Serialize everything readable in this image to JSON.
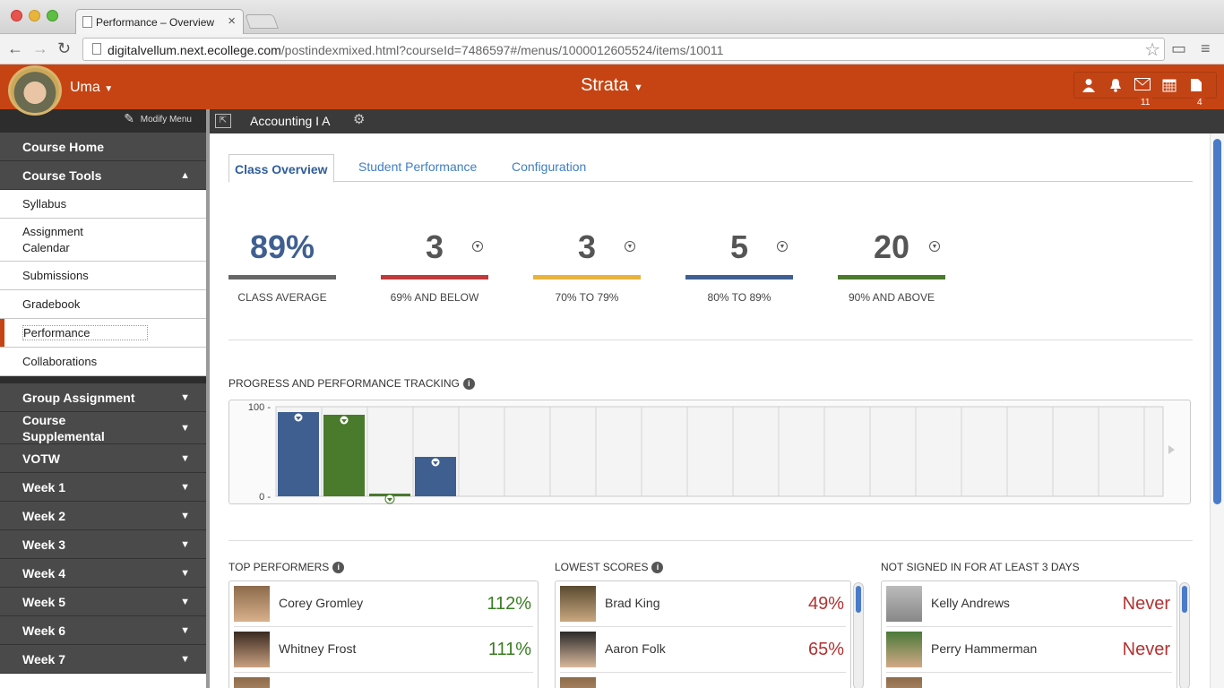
{
  "browser": {
    "tab_title": "Performance – Overview",
    "url_host": "digitalvellum.next.ecollege.com",
    "url_path": "/postindexmixed.html?courseId=7486597#/menus/1000012605524/items/10011"
  },
  "header": {
    "user_name": "Uma",
    "brand": "Strata",
    "mail_badge": "11",
    "docs_badge": "4"
  },
  "sidebar": {
    "modify_menu": "Modify Menu",
    "course_home": "Course Home",
    "course_tools": "Course Tools",
    "tool_items": [
      "Syllabus",
      "Assignment Calendar",
      "Submissions",
      "Gradebook",
      "Performance",
      "Collaborations"
    ],
    "sections": [
      "Group Assignment",
      "Course Supplemental",
      "VOTW",
      "Week 1",
      "Week 2",
      "Week 3",
      "Week 4",
      "Week 5",
      "Week 6",
      "Week 7"
    ]
  },
  "course": {
    "title": "Accounting I A"
  },
  "tabs": [
    "Class Overview",
    "Student Performance",
    "Configuration"
  ],
  "stats": [
    {
      "value": "89%",
      "label": "CLASS AVERAGE",
      "color": "#666666"
    },
    {
      "value": "3",
      "label": "69% AND BELOW",
      "color": "#c0393b"
    },
    {
      "value": "3",
      "label": "70% TO 79%",
      "color": "#e8b33d"
    },
    {
      "value": "5",
      "label": "80% TO 89%",
      "color": "#3f5f91"
    },
    {
      "value": "20",
      "label": "90% AND ABOVE",
      "color": "#4a7a2c"
    }
  ],
  "tracking": {
    "title": "PROGRESS AND PERFORMANCE TRACKING",
    "chart_data": {
      "type": "bar",
      "ylim": [
        0,
        100
      ],
      "yticks": [
        "100",
        "0"
      ],
      "slots": 19,
      "values": [
        94,
        91,
        3,
        44
      ],
      "colors": [
        "#3f5f91",
        "#4a7a2c",
        "#4a7a2c",
        "#3f5f91"
      ]
    }
  },
  "top_performers": {
    "title": "TOP PERFORMERS",
    "rows": [
      {
        "name": "Corey Gromley",
        "value": "112%"
      },
      {
        "name": "Whitney Frost",
        "value": "111%"
      }
    ]
  },
  "lowest_scores": {
    "title": "LOWEST SCORES",
    "rows": [
      {
        "name": "Brad King",
        "value": "49%"
      },
      {
        "name": "Aaron Folk",
        "value": "65%"
      }
    ]
  },
  "not_signed_in": {
    "title": "NOT SIGNED IN FOR AT LEAST 3 DAYS",
    "rows": [
      {
        "name": "Kelly Andrews",
        "value": "Never"
      },
      {
        "name": "Perry Hammerman",
        "value": "Never"
      }
    ]
  }
}
